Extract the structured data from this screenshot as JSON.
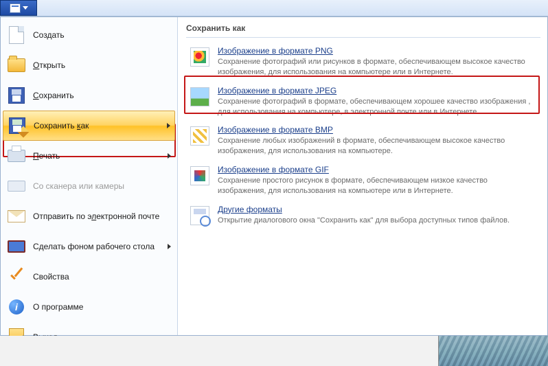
{
  "ribbon": {
    "app_button": "app-menu"
  },
  "left_menu": {
    "items": [
      {
        "key": "create",
        "label": "Создать",
        "icon": "sheet"
      },
      {
        "key": "open",
        "label": "Открыть",
        "icon": "folder",
        "underline_index": 0
      },
      {
        "key": "save",
        "label": "Сохранить",
        "icon": "floppy",
        "underline_index": 0
      },
      {
        "key": "saveas",
        "label": "Сохранить как",
        "icon": "floppy-pen",
        "underline_index": 10,
        "has_arrow": true,
        "selected": true
      },
      {
        "key": "print",
        "label": "Печать",
        "icon": "printer",
        "underline_index": 0,
        "has_arrow": true
      },
      {
        "key": "scanner",
        "label": "Со сканера или камеры",
        "icon": "scanner",
        "disabled": true
      },
      {
        "key": "email",
        "label": "Отправить по электронной почте",
        "icon": "mail",
        "underline_index": 14
      },
      {
        "key": "wallpaper",
        "label": "Сделать фоном рабочего стола",
        "icon": "desktop",
        "has_arrow": true
      },
      {
        "key": "props",
        "label": "Свойства",
        "icon": "check"
      },
      {
        "key": "about",
        "label": "О программе",
        "icon": "info"
      },
      {
        "key": "exit",
        "label": "Выход",
        "icon": "exit",
        "underline_index": 1
      }
    ]
  },
  "right_panel": {
    "title": "Сохранить как",
    "formats": [
      {
        "key": "png",
        "title": "Изображение в формате PNG",
        "underline_index": 0,
        "desc": "Сохранение фотографий или рисунков в формате, обеспечивающем высокое качество изображения, для использования на компьютере или в Интернете."
      },
      {
        "key": "jpeg",
        "title": "Изображение в формате JPEG",
        "underline_index": 6,
        "desc": "Сохранение фотографий в формате, обеспечивающем хорошее качество изображения , для использования на компьютере, в электронной почте или в Интернете.",
        "highlighted": true
      },
      {
        "key": "bmp",
        "title": "Изображение в формате BMP",
        "underline_index": 15,
        "desc": "Сохранение любых изображений в формате, обеспечивающем высокое качество изображения, для использования на компьютере."
      },
      {
        "key": "gif",
        "title": "Изображение в формате GIF",
        "underline_index": 1,
        "desc": "Сохранение простого рисунок в формате, обеспечивающем низкое качество изображения, для использования на компьютере или в Интернете."
      },
      {
        "key": "other",
        "title": "Другие форматы",
        "underline_index": 0,
        "desc": "Открытие диалогового окна \"Сохранить как\" для выбора доступных типов файлов."
      }
    ]
  }
}
